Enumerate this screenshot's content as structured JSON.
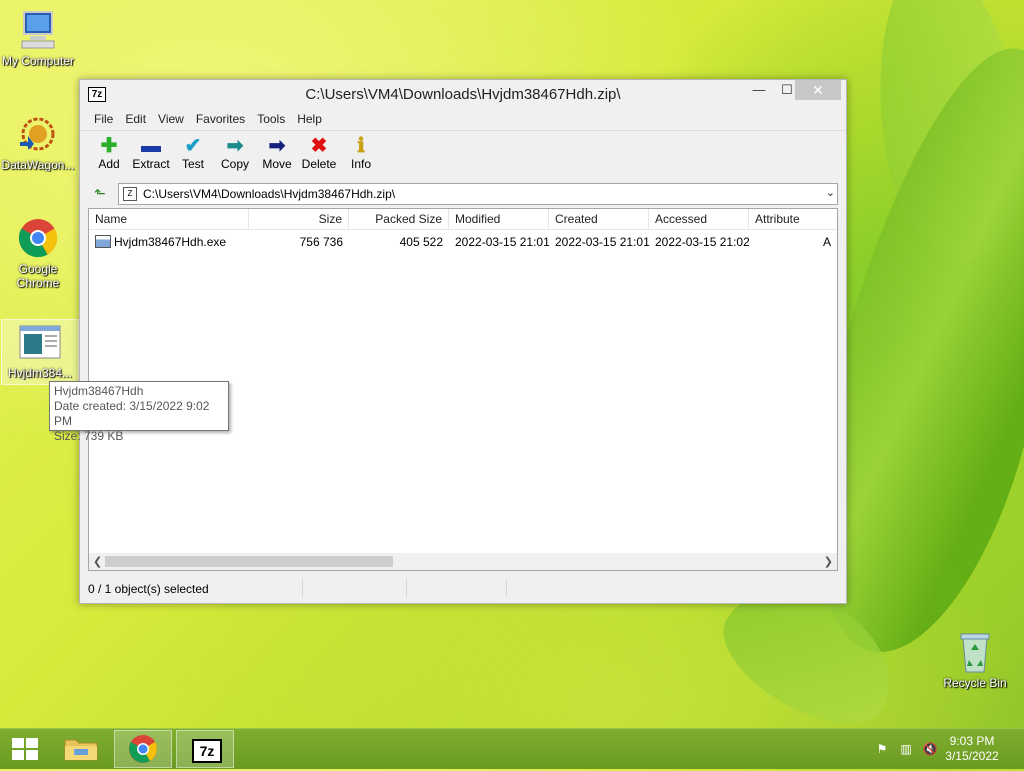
{
  "desktop": {
    "icons": [
      {
        "label": "My Computer"
      },
      {
        "label": "DataWagon..."
      },
      {
        "label": "Google Chrome"
      },
      {
        "label": "Hvjdm384..."
      },
      {
        "label": "Recycle Bin"
      }
    ]
  },
  "window": {
    "app_icon": "7z",
    "title": "C:\\Users\\VM4\\Downloads\\Hvjdm38467Hdh.zip\\",
    "controls": {
      "minimize": "—",
      "maximize": "☐",
      "close": "✕"
    },
    "menu": [
      "File",
      "Edit",
      "View",
      "Favorites",
      "Tools",
      "Help"
    ],
    "toolbar": [
      {
        "label": "Add",
        "icon": "plus-icon",
        "glyph": "✚"
      },
      {
        "label": "Extract",
        "icon": "minus-icon",
        "glyph": "▬"
      },
      {
        "label": "Test",
        "icon": "check-icon",
        "glyph": "✔"
      },
      {
        "label": "Copy",
        "icon": "copy-arrow-icon",
        "glyph": "➡"
      },
      {
        "label": "Move",
        "icon": "move-arrow-icon",
        "glyph": "➡"
      },
      {
        "label": "Delete",
        "icon": "delete-x-icon",
        "glyph": "✖"
      },
      {
        "label": "Info",
        "icon": "info-icon",
        "glyph": "ℹ"
      }
    ],
    "address": "C:\\Users\\VM4\\Downloads\\Hvjdm38467Hdh.zip\\",
    "columns": [
      "Name",
      "Size",
      "Packed Size",
      "Modified",
      "Created",
      "Accessed",
      "Attribute"
    ],
    "rows": [
      {
        "name": "Hvjdm38467Hdh.exe",
        "size": "756 736",
        "packed": "405 522",
        "modified": "2022-03-15 21:01",
        "created": "2022-03-15 21:01",
        "accessed": "2022-03-15 21:02",
        "attr": "A"
      }
    ],
    "status": "0 / 1 object(s) selected"
  },
  "tooltip": {
    "line1": "Hvjdm38467Hdh",
    "line2": "Date created: 3/15/2022 9:02 PM",
    "line3": "Size: 739 KB"
  },
  "taskbar": {
    "items": [
      {
        "name": "File Explorer"
      },
      {
        "name": "Google Chrome"
      },
      {
        "name": "7-Zip",
        "label": "7z"
      }
    ],
    "time": "9:03 PM",
    "date": "3/15/2022"
  },
  "colors": {
    "accent": "#6a9a22",
    "close_button": "#c7c7c7"
  }
}
